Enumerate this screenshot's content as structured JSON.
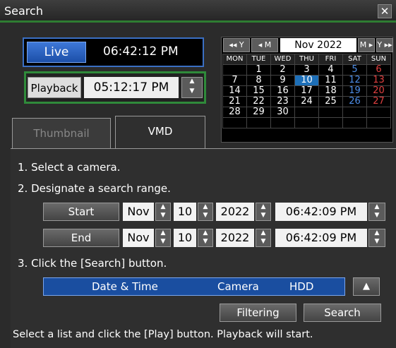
{
  "window": {
    "title": "Search",
    "close_label": "✕"
  },
  "live": {
    "label": "Live",
    "time": "06:42:12 PM"
  },
  "playback": {
    "label": "Playback",
    "time": "05:12:17 PM"
  },
  "calendar": {
    "nav": {
      "prev_year": "◂◂ Y",
      "prev_month": "◂ M",
      "month_label": "Nov 2022",
      "next_month": "M ▸",
      "next_year": "Y ▸▸"
    },
    "dow": [
      "MON",
      "TUE",
      "WED",
      "THU",
      "FRI",
      "SAT",
      "SUN"
    ],
    "weeks": [
      [
        "",
        "1",
        "2",
        "3",
        "4",
        "5",
        "6"
      ],
      [
        "7",
        "8",
        "9",
        "10",
        "11",
        "12",
        "13"
      ],
      [
        "14",
        "15",
        "16",
        "17",
        "18",
        "19",
        "20"
      ],
      [
        "21",
        "22",
        "23",
        "24",
        "25",
        "26",
        "27"
      ],
      [
        "28",
        "29",
        "30",
        "",
        "",
        "",
        ""
      ],
      [
        "",
        "",
        "",
        "",
        "",
        "",
        ""
      ]
    ],
    "selected_day": "10",
    "colors": {
      "saturday": "#4e8ee8",
      "sunday": "#e04040",
      "selected": "#1d6fb8"
    }
  },
  "tabs": [
    {
      "label": "Thumbnail",
      "active": false
    },
    {
      "label": "VMD",
      "active": true
    }
  ],
  "steps": {
    "s1": "1. Select a camera.",
    "s2": "2. Designate a search range.",
    "s3": "3. Click the [Search] button.",
    "note": "Select a list and click the [Play] button. Playback will start."
  },
  "range": {
    "start": {
      "label": "Start",
      "month": "Nov",
      "day": "10",
      "year": "2022",
      "time": "06:42:09 PM"
    },
    "end": {
      "label": "End",
      "month": "Nov",
      "day": "10",
      "year": "2022",
      "time": "06:42:09 PM"
    }
  },
  "list": {
    "columns": [
      "Date & Time",
      "Camera",
      "HDD"
    ],
    "sort_icon": "▲"
  },
  "buttons": {
    "filtering": "Filtering",
    "search": "Search"
  }
}
